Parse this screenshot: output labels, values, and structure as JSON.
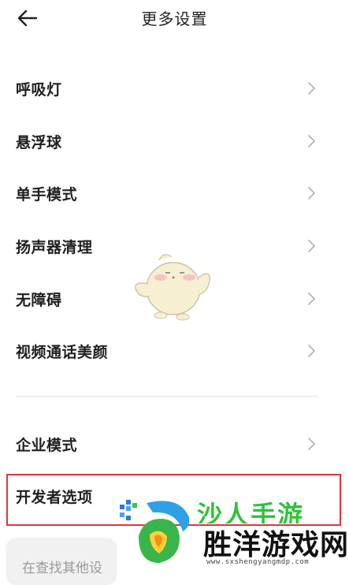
{
  "header": {
    "title": "更多设置",
    "back_icon": "arrow-left-icon"
  },
  "menu": {
    "items": [
      {
        "label": "呼吸灯"
      },
      {
        "label": "悬浮球"
      },
      {
        "label": "单手模式"
      },
      {
        "label": "扬声器清理"
      },
      {
        "label": "无障碍"
      },
      {
        "label": "视频通话美颜"
      },
      {
        "label": "企业模式"
      },
      {
        "label": "开发者选项"
      }
    ],
    "chevron_icon": "chevron-right-icon"
  },
  "search": {
    "text": "在查找其他设"
  },
  "highlight_color": "#e0343b",
  "watermark": {
    "brand": "沙人手游",
    "name": "胜洋游戏网",
    "url": "www.sxshengyangmdp.com",
    "brand_color": "#31c23b"
  }
}
